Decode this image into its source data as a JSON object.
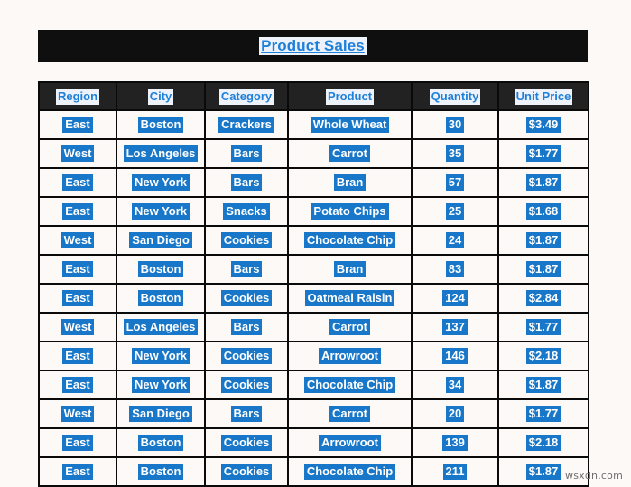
{
  "document": {
    "title": "Product Sales",
    "watermark": "wsxdn.com",
    "colors": {
      "page_background": "#fdf9f7",
      "title_band": "#100f0f",
      "title_text": "#1f80d8",
      "title_highlight": "#eef2fb",
      "header_band": "#222222",
      "header_text": "#1f80d8",
      "header_highlight": "#eef2fb",
      "cell_text": "#ffffff",
      "cell_highlight": "#1877c9",
      "grid_line": "#0a0a0a"
    }
  },
  "table": {
    "columns": [
      {
        "key": "region",
        "label": "Region"
      },
      {
        "key": "city",
        "label": "City"
      },
      {
        "key": "category",
        "label": "Category"
      },
      {
        "key": "product",
        "label": "Product"
      },
      {
        "key": "quantity",
        "label": "Quantity"
      },
      {
        "key": "price",
        "label": "Unit Price"
      }
    ],
    "rows": [
      {
        "region": "East",
        "city": "Boston",
        "category": "Crackers",
        "product": "Whole Wheat",
        "quantity": "30",
        "price": "$3.49"
      },
      {
        "region": "West",
        "city": "Los Angeles",
        "category": "Bars",
        "product": "Carrot",
        "quantity": "35",
        "price": "$1.77"
      },
      {
        "region": "East",
        "city": "New York",
        "category": "Bars",
        "product": "Bran",
        "quantity": "57",
        "price": "$1.87"
      },
      {
        "region": "East",
        "city": "New York",
        "category": "Snacks",
        "product": "Potato Chips",
        "quantity": "25",
        "price": "$1.68"
      },
      {
        "region": "West",
        "city": "San Diego",
        "category": "Cookies",
        "product": "Chocolate Chip",
        "quantity": "24",
        "price": "$1.87"
      },
      {
        "region": "East",
        "city": "Boston",
        "category": "Bars",
        "product": "Bran",
        "quantity": "83",
        "price": "$1.87"
      },
      {
        "region": "East",
        "city": "Boston",
        "category": "Cookies",
        "product": "Oatmeal Raisin",
        "quantity": "124",
        "price": "$2.84"
      },
      {
        "region": "West",
        "city": "Los Angeles",
        "category": "Bars",
        "product": "Carrot",
        "quantity": "137",
        "price": "$1.77"
      },
      {
        "region": "East",
        "city": "New York",
        "category": "Cookies",
        "product": "Arrowroot",
        "quantity": "146",
        "price": "$2.18"
      },
      {
        "region": "East",
        "city": "New York",
        "category": "Cookies",
        "product": "Chocolate Chip",
        "quantity": "34",
        "price": "$1.87"
      },
      {
        "region": "West",
        "city": "San Diego",
        "category": "Bars",
        "product": "Carrot",
        "quantity": "20",
        "price": "$1.77"
      },
      {
        "region": "East",
        "city": "Boston",
        "category": "Cookies",
        "product": "Arrowroot",
        "quantity": "139",
        "price": "$2.18"
      },
      {
        "region": "East",
        "city": "Boston",
        "category": "Cookies",
        "product": "Chocolate Chip",
        "quantity": "211",
        "price": "$1.87"
      }
    ]
  }
}
